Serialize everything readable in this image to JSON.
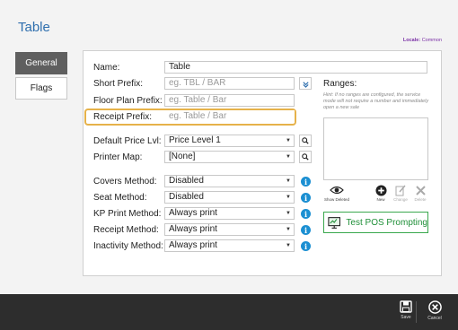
{
  "page": {
    "title": "Table"
  },
  "locale": {
    "label": "Locale:",
    "value": "Common"
  },
  "sidebar": {
    "items": [
      {
        "label": "General"
      },
      {
        "label": "Flags"
      }
    ]
  },
  "form": {
    "name": {
      "label": "Name:",
      "value": "Table"
    },
    "short_prefix": {
      "label": "Short Prefix:",
      "placeholder": "eg. TBL / BAR"
    },
    "floor_plan_prefix": {
      "label": "Floor Plan Prefix:",
      "placeholder": "eg. Table / Bar"
    },
    "receipt_prefix": {
      "label": "Receipt Prefix:",
      "placeholder": "eg. Table / Bar"
    },
    "default_price_lvl": {
      "label": "Default Price Lvl:",
      "value": "Price Level 1"
    },
    "printer_map": {
      "label": "Printer Map:",
      "value": "[None]"
    },
    "covers_method": {
      "label": "Covers Method:",
      "value": "Disabled"
    },
    "seat_method": {
      "label": "Seat Method:",
      "value": "Disabled"
    },
    "kp_print_method": {
      "label": "KP Print Method:",
      "value": "Always print"
    },
    "receipt_method": {
      "label": "Receipt Method:",
      "value": "Always print"
    },
    "inactivity_method": {
      "label": "Inactivity Method:",
      "value": "Always print"
    }
  },
  "ranges": {
    "title": "Ranges:",
    "hint": "Hint: If no ranges are configured, the service mode will not require a number and immediately open a new sale",
    "buttons": {
      "show_deleted": "Show Deleted",
      "new": "New",
      "change": "Change",
      "delete": "Delete"
    },
    "test_button": "Test POS Prompting"
  },
  "bottom": {
    "save": "Save",
    "cancel": "Cancel"
  },
  "colors": {
    "accent_blue": "#2f6fae",
    "highlight": "#e6b24a",
    "info": "#1b8fd2",
    "test_green": "#3aa84d",
    "bottom_bar": "#2d2d2d"
  },
  "icons": {
    "info": "info-icon",
    "search": "search-icon",
    "view": "eye-icon",
    "add": "plus-circle-icon",
    "edit": "edit-icon",
    "remove": "x-icon",
    "save": "floppy-disk-icon",
    "cancel": "close-circle-icon",
    "test": "monitor-icon"
  }
}
